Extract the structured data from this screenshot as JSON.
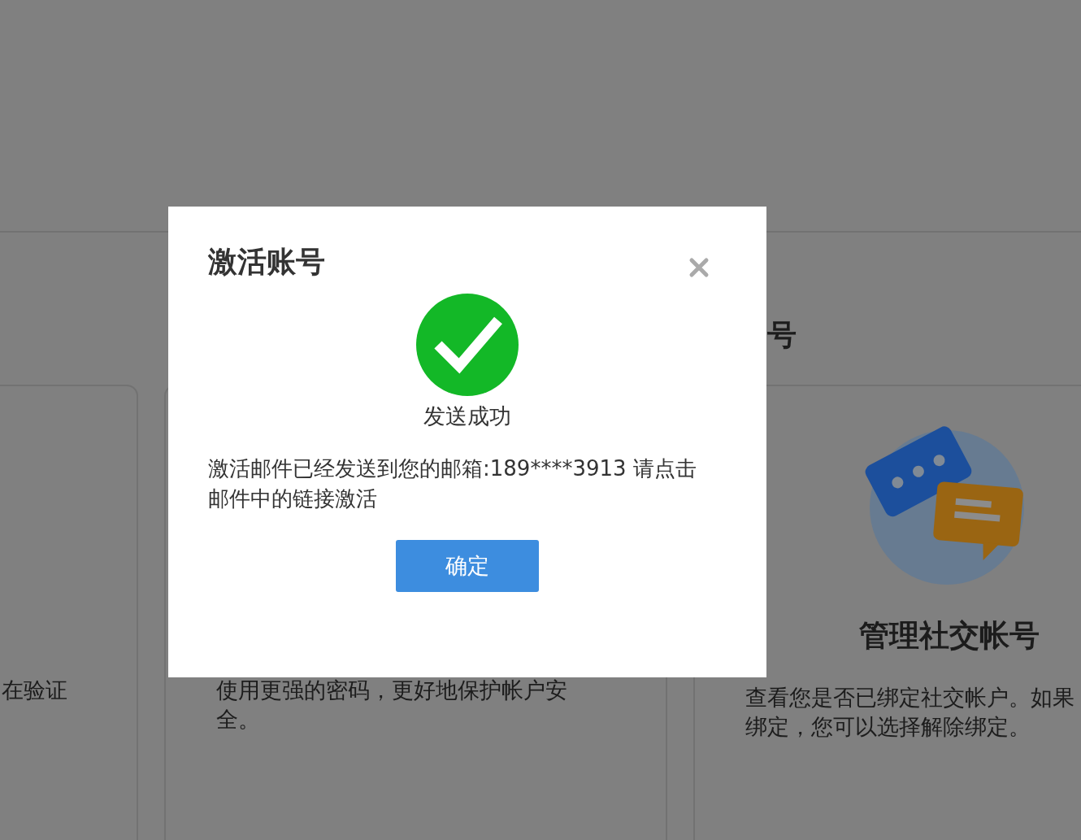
{
  "page": {
    "partial_heading": "号",
    "cards": [
      {
        "kind": "plain",
        "description": "在验证"
      },
      {
        "kind": "plain",
        "description": "使用更强的密码，更好地保护帐户安全。"
      },
      {
        "kind": "icon",
        "title": "管理社交帐号",
        "description": "查看您是否已绑定社交帐户。如果绑定，您可以选择解除绑定。"
      }
    ]
  },
  "dialog": {
    "title": "激活账号",
    "status": "发送成功",
    "message": "激活邮件已经发送到您的邮箱:189****3913 请点击邮件中的链接激活",
    "button": "确定"
  }
}
